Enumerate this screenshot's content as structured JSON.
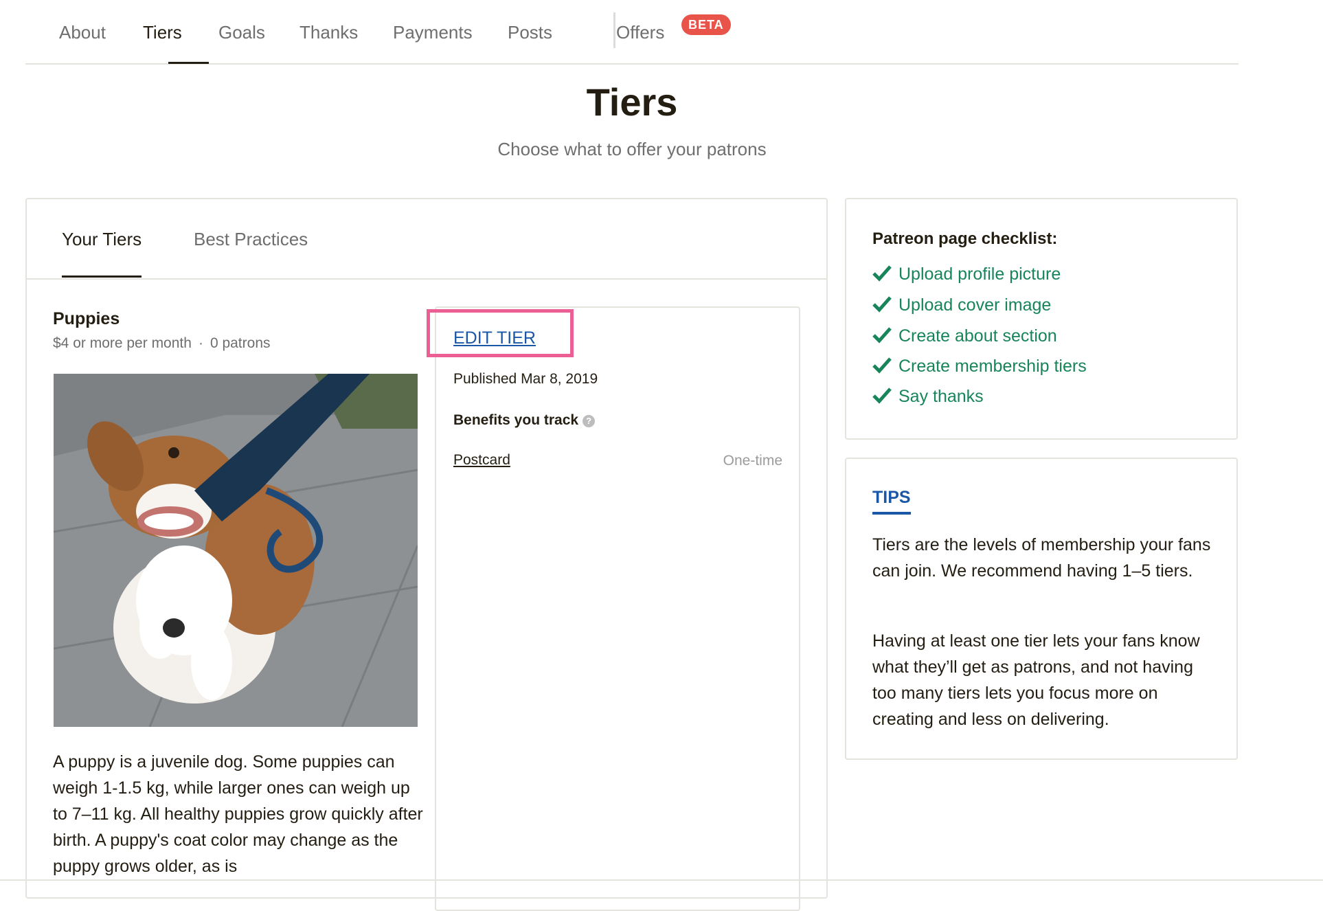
{
  "nav": {
    "items": [
      {
        "label": "About"
      },
      {
        "label": "Tiers"
      },
      {
        "label": "Goals"
      },
      {
        "label": "Thanks"
      },
      {
        "label": "Payments"
      },
      {
        "label": "Posts"
      },
      {
        "label": "Offers"
      }
    ],
    "active": "Tiers",
    "beta_badge": "BETA"
  },
  "header": {
    "title": "Tiers",
    "subtitle": "Choose what to offer your patrons"
  },
  "main": {
    "tabs": [
      {
        "label": "Your Tiers",
        "active": true
      },
      {
        "label": "Best Practices",
        "active": false
      }
    ],
    "tier": {
      "name": "Puppies",
      "price": "$4 or more per month",
      "separator": "·",
      "patrons": "0 patrons",
      "description": "A  puppy is a juvenile dog. Some puppies can weigh 1-1.5 kg, while larger ones can weigh up to 7–11 kg. All healthy puppies grow quickly after birth. A puppy's coat color may change as the puppy grows older, as is",
      "edit_label": "EDIT TIER",
      "published": "Published Mar 8, 2019",
      "benefits_title": "Benefits you track",
      "help_glyph": "?",
      "benefits": [
        {
          "name": "Postcard",
          "frequency": "One-time"
        }
      ]
    }
  },
  "checklist": {
    "title": "Patreon page checklist:",
    "items": [
      {
        "label": "Upload profile picture"
      },
      {
        "label": "Upload cover image"
      },
      {
        "label": "Create about section"
      },
      {
        "label": "Create membership tiers"
      },
      {
        "label": "Say thanks"
      }
    ]
  },
  "tips": {
    "title": "TIPS",
    "paragraphs": [
      "Tiers are the levels of membership your fans can join. We recommend having 1–5 tiers.",
      "Having at least one tier lets your fans know what they’ll get as patrons, and not having too many tiers lets you focus more on creating and less on delivering."
    ]
  },
  "colors": {
    "text": "#241e12",
    "muted": "#6e6e6e",
    "link_blue": "#1a57a6",
    "check_green": "#17845a",
    "beta_red": "#e8534a",
    "highlight_pink": "#ec5f95",
    "border": "#e5e3dd"
  },
  "icons": {
    "check": "checkmark-icon",
    "help": "help-circle-icon"
  }
}
